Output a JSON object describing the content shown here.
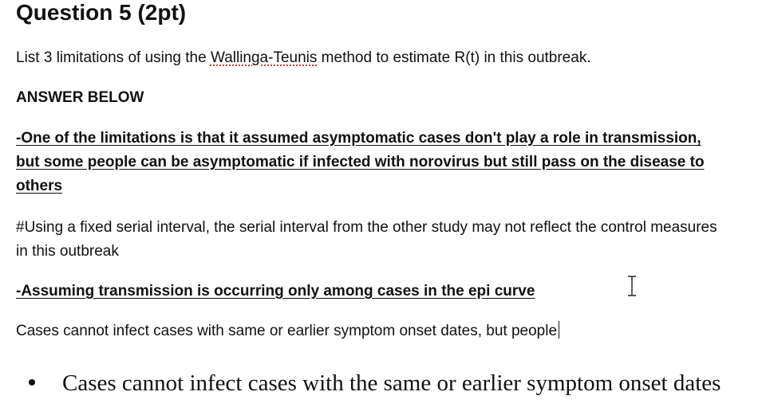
{
  "question": {
    "title": "Question 5 (2pt)",
    "prompt_prefix": "List 3 limitations of using the ",
    "prompt_term": "Wallinga-Teunis",
    "prompt_suffix": " method to estimate R(t) in this outbreak."
  },
  "answer": {
    "label": "ANSWER BELOW",
    "limitation_1": {
      "line_1": "-One of the limitations is that it assumed asymptomatic cases don't play a role in transmission,",
      "line_2": "but some people can be asymptomatic if infected with norovirus but still pass on the disease to",
      "line_3": "others"
    },
    "limitation_2": {
      "line_1": "#Using a fixed serial interval, the serial interval from the other study may not reflect the control measures",
      "line_2": "in this outbreak"
    },
    "limitation_3": "-Assuming transmission is occurring only among cases in the epi curve",
    "draft_text": "Cases cannot infect cases with same or earlier symptom onset dates, but people"
  },
  "slide_bullet": "Cases cannot infect cases with the same or earlier symptom onset dates",
  "icons": {
    "text_cursor": "i-beam-cursor-icon",
    "bullet": "bullet-dot-icon"
  }
}
